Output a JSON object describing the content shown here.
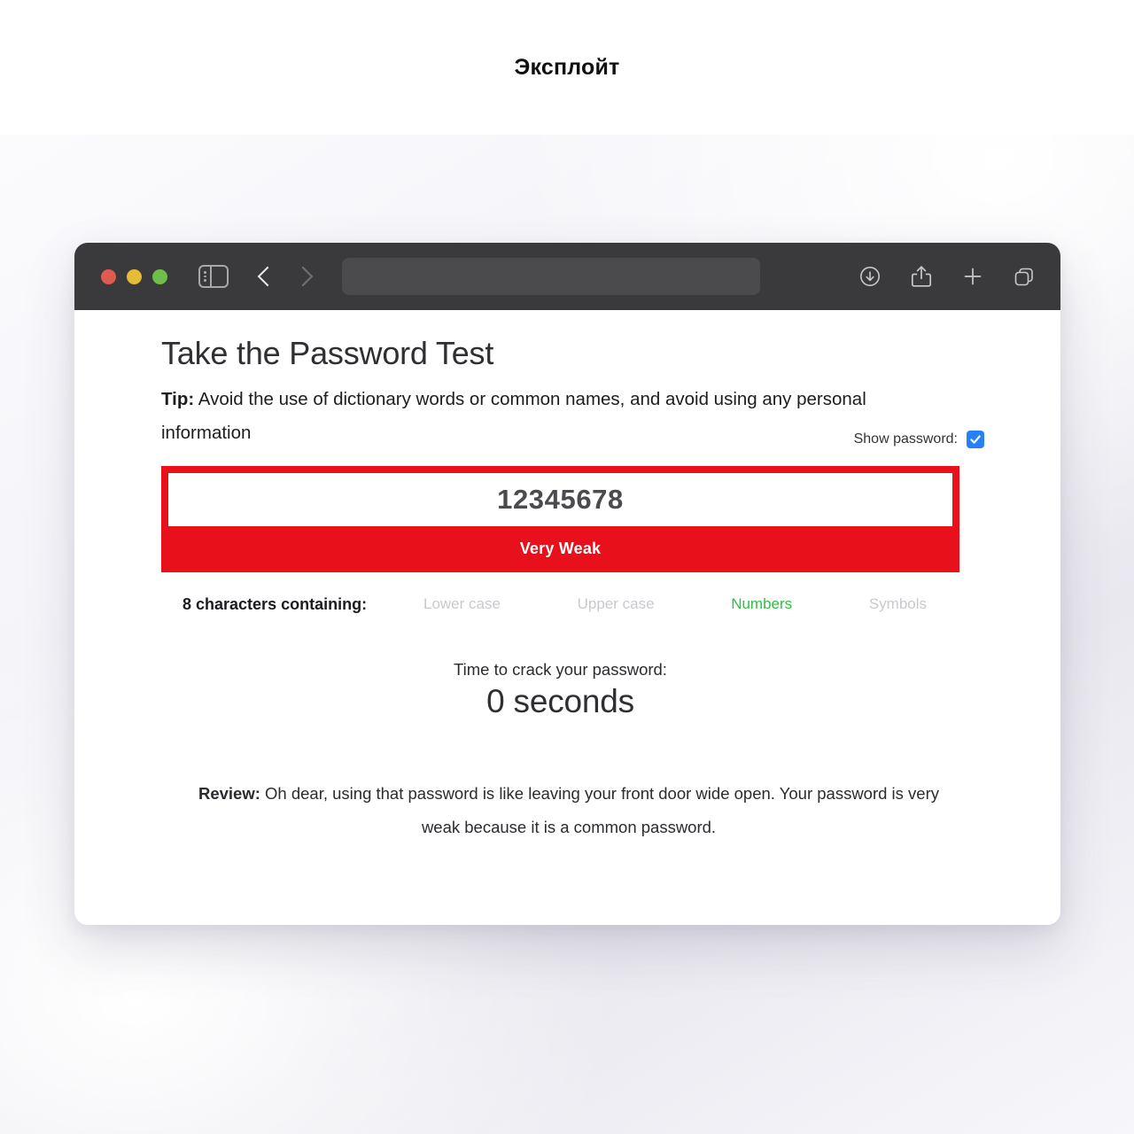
{
  "caption": {
    "title": "Эксплойт"
  },
  "browser": {
    "traffic_lights": [
      {
        "name": "close",
        "color": "#e15a4f"
      },
      {
        "name": "minimize",
        "color": "#e6bb38"
      },
      {
        "name": "maximize",
        "color": "#6fbe47"
      }
    ],
    "sidebar_toggle_icon": "sidebar-icon",
    "back_icon": "chevron-left-icon",
    "forward_icon": "chevron-right-icon",
    "address_bar": {
      "value": "",
      "placeholder": ""
    },
    "right_icons": [
      "download-icon",
      "share-icon",
      "plus-icon",
      "tabs-icon"
    ]
  },
  "page": {
    "headline": "Take the Password Test",
    "tip_label": "Tip:",
    "tip_text": " Avoid the use of dictionary words or common names, and avoid using any personal information",
    "show_password_label": "Show password:",
    "show_password_checked": true,
    "password_value": "12345678",
    "strength_label": "Very Weak",
    "strength_color": "#e8111b",
    "charset_title": "8 characters containing:",
    "charset_items": [
      {
        "label": "Lower case",
        "active": false
      },
      {
        "label": "Upper case",
        "active": false
      },
      {
        "label": "Numbers",
        "active": true
      },
      {
        "label": "Symbols",
        "active": false
      }
    ],
    "active_color": "#2fc041",
    "inactive_color": "#c9c9ce",
    "crack_label": "Time to crack your password:",
    "crack_value": "0 seconds",
    "review_label": "Review:",
    "review_text": " Oh dear, using that password is like leaving your front door wide open. Your password is very weak because it is a common password."
  }
}
